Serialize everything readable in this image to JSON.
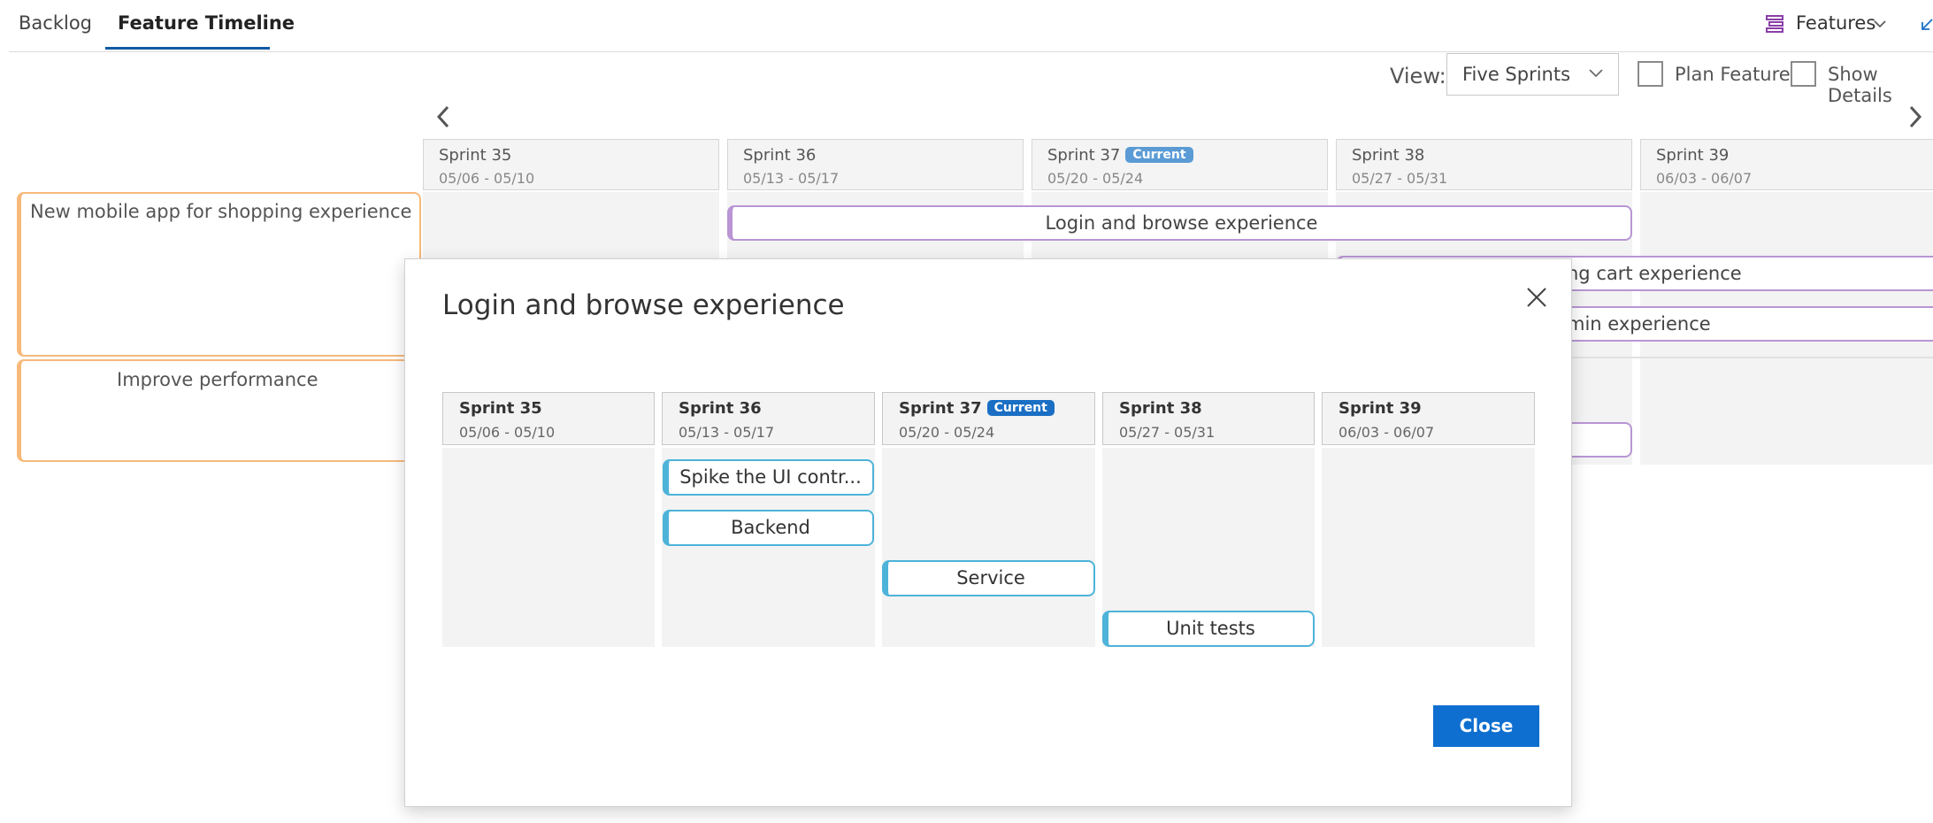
{
  "tabs": [
    {
      "label": "Backlog"
    },
    {
      "label": "Feature Timeline"
    }
  ],
  "features_picker": {
    "label": "Features"
  },
  "view": {
    "label": "View:",
    "selected": "Five Sprints"
  },
  "plan_features": {
    "label": "Plan Features",
    "checked": false
  },
  "show_details": {
    "label": "Show Details",
    "checked": false
  },
  "sprints": [
    {
      "name": "Sprint 35",
      "dates": "05/06 - 05/10"
    },
    {
      "name": "Sprint 36",
      "dates": "05/13 - 05/17"
    },
    {
      "name": "Sprint 37",
      "dates": "05/20 - 05/24",
      "badge": "Current"
    },
    {
      "name": "Sprint 38",
      "dates": "05/27 - 05/31"
    },
    {
      "name": "Sprint 39",
      "dates": "06/03 - 06/07"
    }
  ],
  "epics": [
    {
      "title": "New mobile app for shopping experience"
    },
    {
      "title": "Improve performance"
    }
  ],
  "features": [
    {
      "title": "Login and browse experience"
    },
    {
      "title": "ng cart experience"
    },
    {
      "title": "min experience"
    }
  ],
  "modal": {
    "title": "Login and browse experience",
    "close_label": "Close",
    "stories": [
      {
        "title": "Spike the UI contr..."
      },
      {
        "title": "Backend"
      },
      {
        "title": "Service"
      },
      {
        "title": "Unit tests"
      }
    ]
  },
  "colors": {
    "accent": "#0f6fd0",
    "epic_border": "#f7b97a",
    "feature_border": "#b995d4",
    "story_border": "#4db3d9"
  }
}
